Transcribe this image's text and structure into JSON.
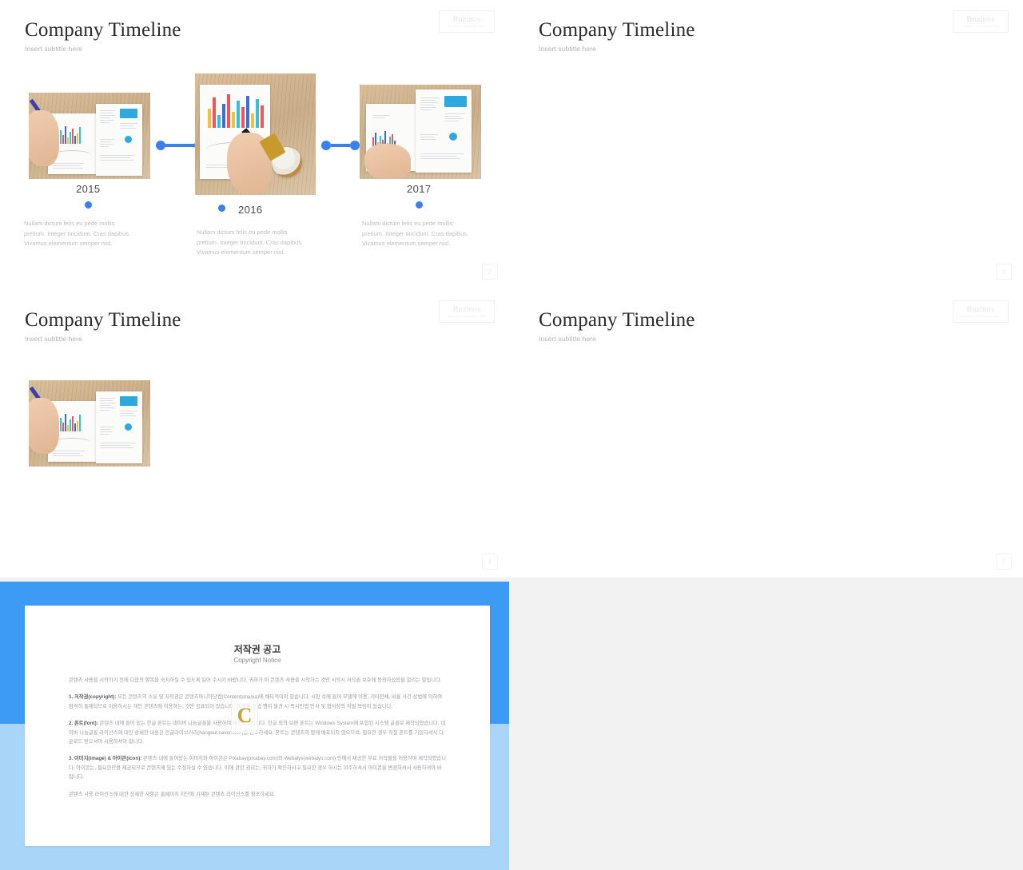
{
  "deck": {
    "brand": {
      "name": "Buzinos",
      "tagline": "Business Presentation Slide"
    },
    "common": {
      "title": "Company Timeline",
      "subtitle": "Insert subtitle here",
      "body_line_1": "Nullam dictum felis eu pede mollis",
      "body_line_2": "pretium. Integer tincidunt. Cras dapibus.",
      "body_line_3": "Vivamus elementum semper nisl.",
      "years": [
        "2015",
        "2016",
        "2017"
      ]
    },
    "slides": [
      {
        "id": "slide-blue",
        "accent": "#3b7ff0",
        "accent_2": "#3b7ff0",
        "page": "2"
      },
      {
        "id": "slide-green",
        "accent": "#5bcd89",
        "accent_2": "#5bcd89",
        "page": "3"
      },
      {
        "id": "slide-yellow",
        "accent": "#f5c518",
        "accent_2": "#f5c518",
        "page": "4"
      },
      {
        "id": "slide-red",
        "accent": "#e8191b",
        "accent_2": "#f06a5a",
        "page": "5"
      }
    ],
    "copyright": {
      "title_ko": "저작권 공고",
      "title_en": "Copyright Notice",
      "watermark": "C",
      "intro": "콘텐츠 사용을 시작하기 전에 다음의 항목을 숙지하실 수 있도록 읽어 주시기 바랍니다. 귀하가 이 콘텐츠 사용을 시작하는 것만 시작시 저작권 보호에 동의하셨음을 알리는 말입니다.",
      "items": [
        {
          "heading": "1. 저작권(copyright):",
          "text": "모든 콘텐츠의 소유 및 저작권은 콘텐츠마니아닷컴(Contentsmania)에 배타적이며 있습니다. 시판 속에 들어 모델에 이용, 기타전체, 비율 사건 상법에 의하여 엄격히 통제되므로 이용하시는 개인 콘텐츠에 이용하는, 것만 공표되어 있습니다. 이후편 공법 행위 발견 시 즉시민법 민사 및 형사상의 처벌 책임이 있습니다."
        },
        {
          "heading": "2. 폰트(font):",
          "text": "콘텐츠 내에 들어 있는 한글 폰트는 네이버 나눔글꼴을 사용하여 제작되었습니다. 한글 외의 보편 폰트는 Windows System에 포함된 시스템 글꼴로 제작되었습니다. 네이버 나눔글꼴 라이선스에 대한 상세한 내용은 한글라이브러리(hangeul.naver.com)를 참조하세요. 폰트는 콘텐츠의 함께 배포되지 않으므로, 필요한 경우 직접 폰트를 기입하셔서 다운로드 받으셔야 시용하셔야 합니다."
        },
        {
          "heading": "3. 이미지(image) & 아이콘(icon):",
          "text": "콘텐츠 내에 들어있는 이미지와 아이콘은 Pixabay(pixabay.com)와 Webalys(webalys.com) 등에서 제공한 무료 저작물을 이용하여 제작되었습니다. 아이콘는, 필요한만큼 제공되므로 콘텐츠에 있는 수정하실 수 있습니다. 이에 관한 권리는, 귀하가 확인하시고 필요한 경우 하시는 위주하셔서 아이콘을 변경하셔서 사용하셔야 바랍니다."
        }
      ],
      "footer": "콘텐츠 사용 라이선스에 대한 상세한 사항은 홈페이지 하단에 기재된 콘텐츠 라이선스를 참조하세요."
    }
  }
}
